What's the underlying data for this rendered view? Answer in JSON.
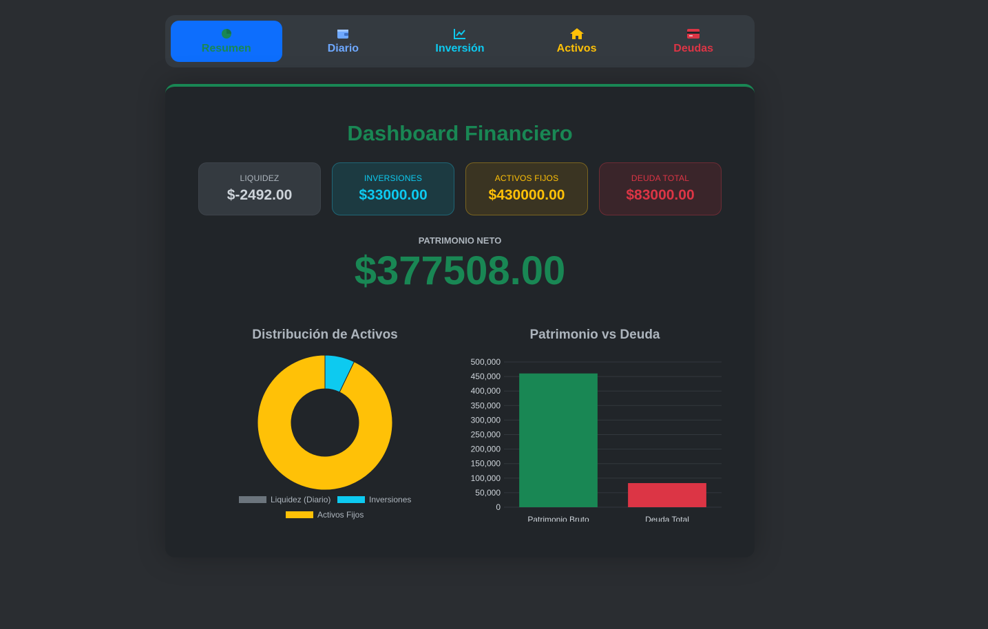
{
  "nav": {
    "items": [
      {
        "label": "Resumen",
        "color": "#198754",
        "active": true
      },
      {
        "label": "Diario",
        "color": "#6ea8fe",
        "active": false
      },
      {
        "label": "Inversión",
        "color": "#0dcaf0",
        "active": false
      },
      {
        "label": "Activos",
        "color": "#ffc107",
        "active": false
      },
      {
        "label": "Deudas",
        "color": "#dc3545",
        "active": false
      }
    ]
  },
  "dashboard": {
    "title": "Dashboard Financiero",
    "stats": [
      {
        "label": "LIQUIDEZ",
        "value": "$-2492.00"
      },
      {
        "label": "INVERSIONES",
        "value": "$33000.00"
      },
      {
        "label": "ACTIVOS FIJOS",
        "value": "$430000.00"
      },
      {
        "label": "DEUDA TOTAL",
        "value": "$83000.00"
      }
    ],
    "net_worth_label": "PATRIMONIO NETO",
    "net_worth_value": "$377508.00"
  },
  "chart_data": [
    {
      "type": "pie",
      "title": "Distribución de Activos",
      "categories": [
        "Liquidez (Diario)",
        "Inversiones",
        "Activos Fijos"
      ],
      "values": [
        0,
        33000,
        430000
      ],
      "colors": [
        "#6c757d",
        "#0dcaf0",
        "#ffc107"
      ],
      "legend": "bottom"
    },
    {
      "type": "bar",
      "title": "Patrimonio vs Deuda",
      "categories": [
        "Patrimonio Bruto",
        "Deuda Total"
      ],
      "values": [
        460508,
        83000
      ],
      "colors": [
        "#198754",
        "#dc3545"
      ],
      "ylim": [
        0,
        500000
      ],
      "yticks": [
        "0",
        "50,000",
        "100,000",
        "150,000",
        "200,000",
        "250,000",
        "300,000",
        "350,000",
        "400,000",
        "450,000",
        "500,000"
      ],
      "grid": true
    }
  ]
}
